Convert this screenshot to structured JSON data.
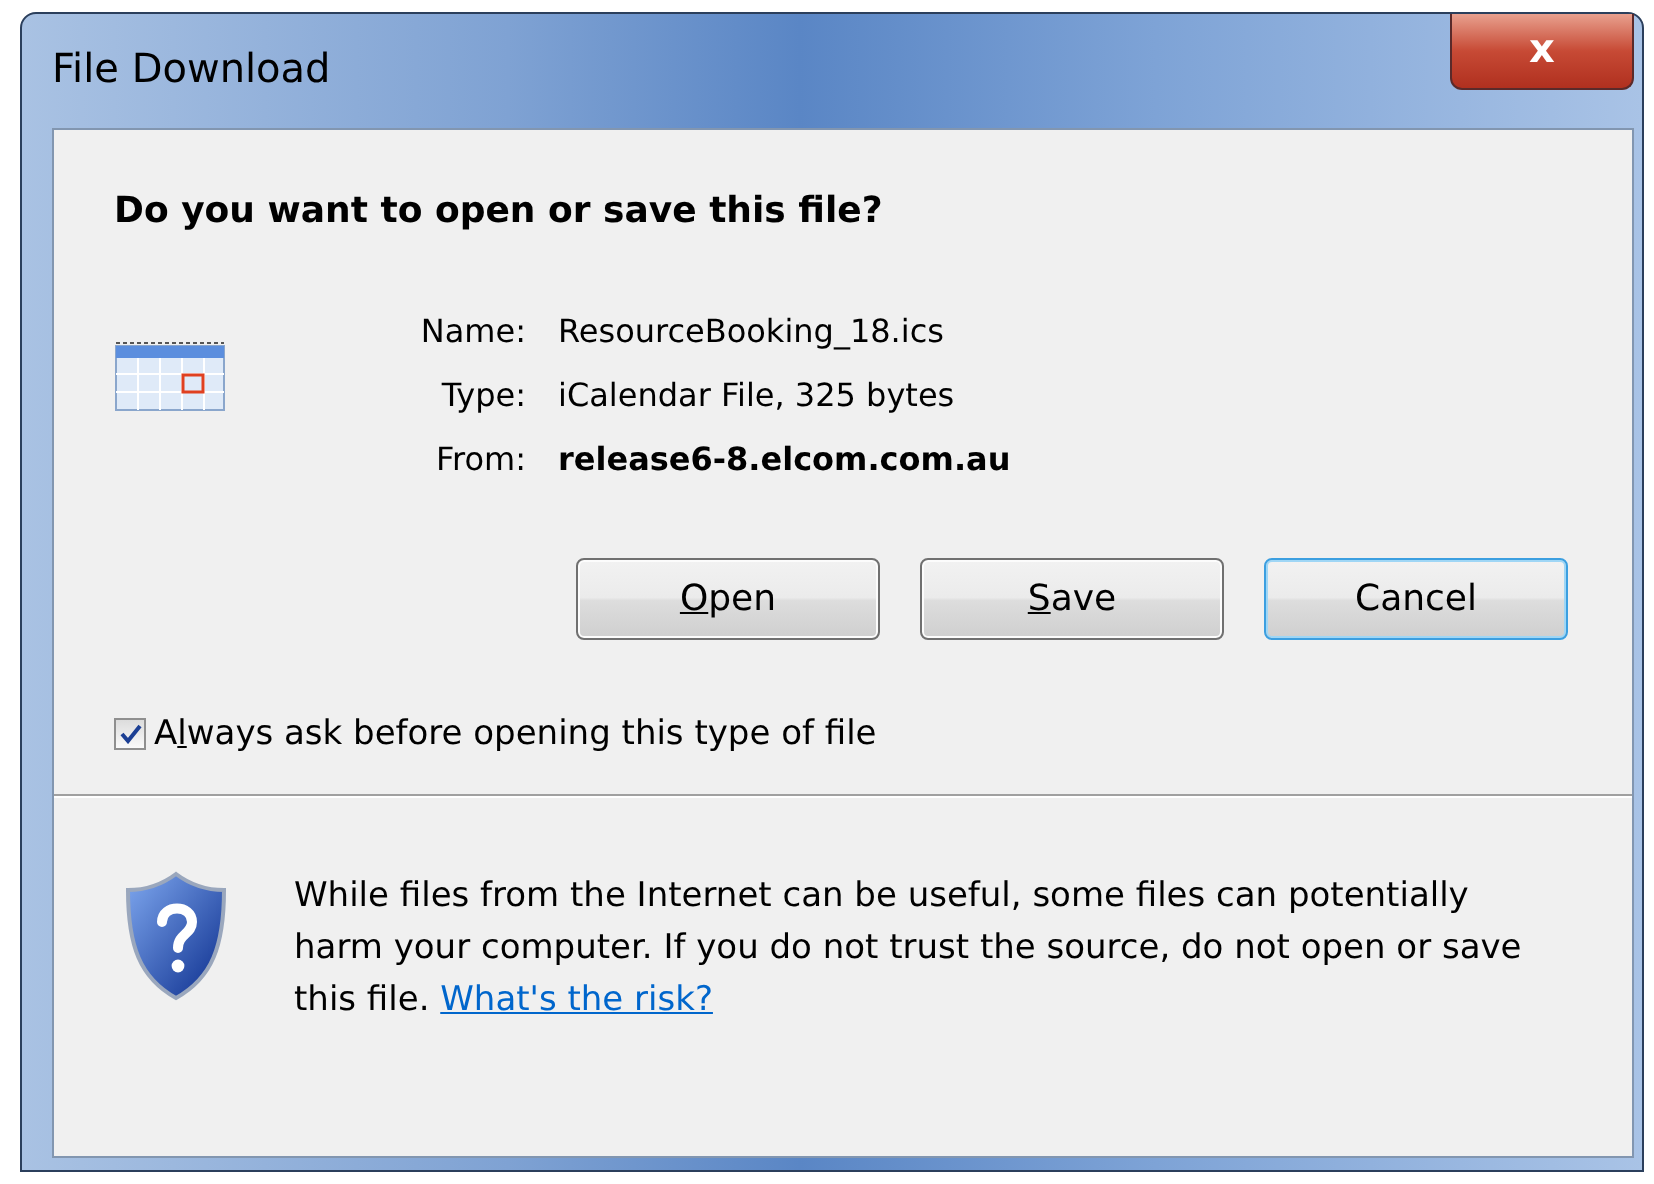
{
  "window": {
    "title": "File Download",
    "close_label": "x"
  },
  "heading": "Do you want to open or save this file?",
  "file_info": [
    {
      "label": "Name:",
      "value": "ResourceBooking_18.ics",
      "bold": false
    },
    {
      "label": "Type:",
      "value": "iCalendar File, 325 bytes",
      "bold": false
    },
    {
      "label": "From:",
      "value": "release6-8.elcom.com.au",
      "bold": true
    }
  ],
  "buttons": [
    {
      "mnemonic": "O",
      "label": "pen",
      "focused": false
    },
    {
      "mnemonic": "S",
      "label": "ave",
      "focused": false
    },
    {
      "label": "Cancel",
      "focused": true
    }
  ],
  "always_ask": {
    "before": "A",
    "mnemonic": "l",
    "after": "ways ask before opening this type of file",
    "checked": true
  },
  "warning": {
    "text": "While files from the Internet can be useful, some files can potentially harm your computer. If you do not trust the source, do not open or save this file.",
    "link": "What's the risk?"
  }
}
